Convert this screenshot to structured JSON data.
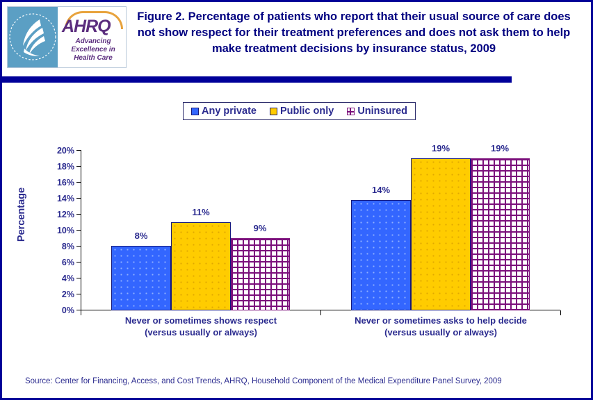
{
  "figure": {
    "title": "Figure 2. Percentage of patients who report that their usual source of care does not show respect for their treatment preferences and does not ask them to help make treatment decisions by insurance status, 2009",
    "source": "Source: Center for Financing, Access, and Cost Trends, AHRQ,  Household Component of the Medical Expenditure Panel Survey,  2009"
  },
  "logo": {
    "agency_acronym": "AHRQ",
    "tagline_line1": "Advancing",
    "tagline_line2": "Excellence in",
    "tagline_line3": "Health Care",
    "seal_name": "hhs-seal-icon"
  },
  "legend": {
    "items": [
      {
        "label": "Any private",
        "swatch": "sw-private",
        "color": "#3366FF"
      },
      {
        "label": "Public only",
        "swatch": "sw-public",
        "color": "#FFCC00"
      },
      {
        "label": "Uninsured",
        "swatch": "sw-uninsured",
        "color": "#7B0F7B"
      }
    ]
  },
  "axes": {
    "y_title": "Percentage",
    "y_ticks": [
      "20%",
      "18%",
      "16%",
      "14%",
      "12%",
      "10%",
      "8%",
      "6%",
      "4%",
      "2%",
      "0%"
    ],
    "x_labels": [
      {
        "line1": "Never or sometimes shows respect",
        "line2": "(versus usually or always)"
      },
      {
        "line1": "Never or sometimes asks to help decide",
        "line2": "(versus usually or always)"
      }
    ]
  },
  "bars": [
    {
      "value_label": "8%",
      "series": "Any private",
      "group": 0
    },
    {
      "value_label": "11%",
      "series": "Public only",
      "group": 0
    },
    {
      "value_label": "9%",
      "series": "Uninsured",
      "group": 0
    },
    {
      "value_label": "14%",
      "series": "Any private",
      "group": 1
    },
    {
      "value_label": "19%",
      "series": "Public only",
      "group": 1
    },
    {
      "value_label": "19%",
      "series": "Uninsured",
      "group": 1
    }
  ],
  "chart_data": {
    "type": "bar",
    "title": "Figure 2. Percentage of patients who report that their usual source of care does not show respect for their treatment preferences and does not ask them to help make treatment decisions by insurance status, 2009",
    "xlabel": "",
    "ylabel": "Percentage",
    "ylim": [
      0,
      20
    ],
    "ytick_step": 2,
    "ytick_format": "percent",
    "grid": false,
    "legend_position": "top-center",
    "categories": [
      "Never or sometimes shows respect (versus usually or always)",
      "Never or sometimes asks to help decide (versus usually or always)"
    ],
    "series": [
      {
        "name": "Any private",
        "color": "#3366FF",
        "values": [
          8,
          14
        ],
        "data_labels": [
          "8%",
          "14%"
        ]
      },
      {
        "name": "Public only",
        "color": "#FFCC00",
        "values": [
          11,
          19
        ],
        "data_labels": [
          "11%",
          "19%"
        ]
      },
      {
        "name": "Uninsured",
        "color": "#7B0F7B",
        "pattern": "brick",
        "values": [
          9,
          19
        ],
        "data_labels": [
          "9%",
          "19%"
        ]
      }
    ],
    "source": "Source: Center for Financing, Access, and Cost Trends, AHRQ,  Household Component of the Medical Expenditure Panel Survey,  2009"
  }
}
